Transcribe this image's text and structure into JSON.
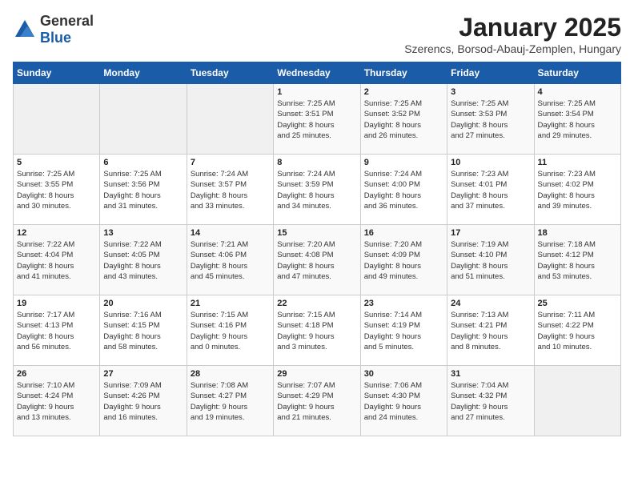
{
  "header": {
    "logo_general": "General",
    "logo_blue": "Blue",
    "month_title": "January 2025",
    "location": "Szerencs, Borsod-Abauj-Zemplen, Hungary"
  },
  "weekdays": [
    "Sunday",
    "Monday",
    "Tuesday",
    "Wednesday",
    "Thursday",
    "Friday",
    "Saturday"
  ],
  "weeks": [
    [
      {
        "day": "",
        "info": ""
      },
      {
        "day": "",
        "info": ""
      },
      {
        "day": "",
        "info": ""
      },
      {
        "day": "1",
        "info": "Sunrise: 7:25 AM\nSunset: 3:51 PM\nDaylight: 8 hours\nand 25 minutes."
      },
      {
        "day": "2",
        "info": "Sunrise: 7:25 AM\nSunset: 3:52 PM\nDaylight: 8 hours\nand 26 minutes."
      },
      {
        "day": "3",
        "info": "Sunrise: 7:25 AM\nSunset: 3:53 PM\nDaylight: 8 hours\nand 27 minutes."
      },
      {
        "day": "4",
        "info": "Sunrise: 7:25 AM\nSunset: 3:54 PM\nDaylight: 8 hours\nand 29 minutes."
      }
    ],
    [
      {
        "day": "5",
        "info": "Sunrise: 7:25 AM\nSunset: 3:55 PM\nDaylight: 8 hours\nand 30 minutes."
      },
      {
        "day": "6",
        "info": "Sunrise: 7:25 AM\nSunset: 3:56 PM\nDaylight: 8 hours\nand 31 minutes."
      },
      {
        "day": "7",
        "info": "Sunrise: 7:24 AM\nSunset: 3:57 PM\nDaylight: 8 hours\nand 33 minutes."
      },
      {
        "day": "8",
        "info": "Sunrise: 7:24 AM\nSunset: 3:59 PM\nDaylight: 8 hours\nand 34 minutes."
      },
      {
        "day": "9",
        "info": "Sunrise: 7:24 AM\nSunset: 4:00 PM\nDaylight: 8 hours\nand 36 minutes."
      },
      {
        "day": "10",
        "info": "Sunrise: 7:23 AM\nSunset: 4:01 PM\nDaylight: 8 hours\nand 37 minutes."
      },
      {
        "day": "11",
        "info": "Sunrise: 7:23 AM\nSunset: 4:02 PM\nDaylight: 8 hours\nand 39 minutes."
      }
    ],
    [
      {
        "day": "12",
        "info": "Sunrise: 7:22 AM\nSunset: 4:04 PM\nDaylight: 8 hours\nand 41 minutes."
      },
      {
        "day": "13",
        "info": "Sunrise: 7:22 AM\nSunset: 4:05 PM\nDaylight: 8 hours\nand 43 minutes."
      },
      {
        "day": "14",
        "info": "Sunrise: 7:21 AM\nSunset: 4:06 PM\nDaylight: 8 hours\nand 45 minutes."
      },
      {
        "day": "15",
        "info": "Sunrise: 7:20 AM\nSunset: 4:08 PM\nDaylight: 8 hours\nand 47 minutes."
      },
      {
        "day": "16",
        "info": "Sunrise: 7:20 AM\nSunset: 4:09 PM\nDaylight: 8 hours\nand 49 minutes."
      },
      {
        "day": "17",
        "info": "Sunrise: 7:19 AM\nSunset: 4:10 PM\nDaylight: 8 hours\nand 51 minutes."
      },
      {
        "day": "18",
        "info": "Sunrise: 7:18 AM\nSunset: 4:12 PM\nDaylight: 8 hours\nand 53 minutes."
      }
    ],
    [
      {
        "day": "19",
        "info": "Sunrise: 7:17 AM\nSunset: 4:13 PM\nDaylight: 8 hours\nand 56 minutes."
      },
      {
        "day": "20",
        "info": "Sunrise: 7:16 AM\nSunset: 4:15 PM\nDaylight: 8 hours\nand 58 minutes."
      },
      {
        "day": "21",
        "info": "Sunrise: 7:15 AM\nSunset: 4:16 PM\nDaylight: 9 hours\nand 0 minutes."
      },
      {
        "day": "22",
        "info": "Sunrise: 7:15 AM\nSunset: 4:18 PM\nDaylight: 9 hours\nand 3 minutes."
      },
      {
        "day": "23",
        "info": "Sunrise: 7:14 AM\nSunset: 4:19 PM\nDaylight: 9 hours\nand 5 minutes."
      },
      {
        "day": "24",
        "info": "Sunrise: 7:13 AM\nSunset: 4:21 PM\nDaylight: 9 hours\nand 8 minutes."
      },
      {
        "day": "25",
        "info": "Sunrise: 7:11 AM\nSunset: 4:22 PM\nDaylight: 9 hours\nand 10 minutes."
      }
    ],
    [
      {
        "day": "26",
        "info": "Sunrise: 7:10 AM\nSunset: 4:24 PM\nDaylight: 9 hours\nand 13 minutes."
      },
      {
        "day": "27",
        "info": "Sunrise: 7:09 AM\nSunset: 4:26 PM\nDaylight: 9 hours\nand 16 minutes."
      },
      {
        "day": "28",
        "info": "Sunrise: 7:08 AM\nSunset: 4:27 PM\nDaylight: 9 hours\nand 19 minutes."
      },
      {
        "day": "29",
        "info": "Sunrise: 7:07 AM\nSunset: 4:29 PM\nDaylight: 9 hours\nand 21 minutes."
      },
      {
        "day": "30",
        "info": "Sunrise: 7:06 AM\nSunset: 4:30 PM\nDaylight: 9 hours\nand 24 minutes."
      },
      {
        "day": "31",
        "info": "Sunrise: 7:04 AM\nSunset: 4:32 PM\nDaylight: 9 hours\nand 27 minutes."
      },
      {
        "day": "",
        "info": ""
      }
    ]
  ]
}
